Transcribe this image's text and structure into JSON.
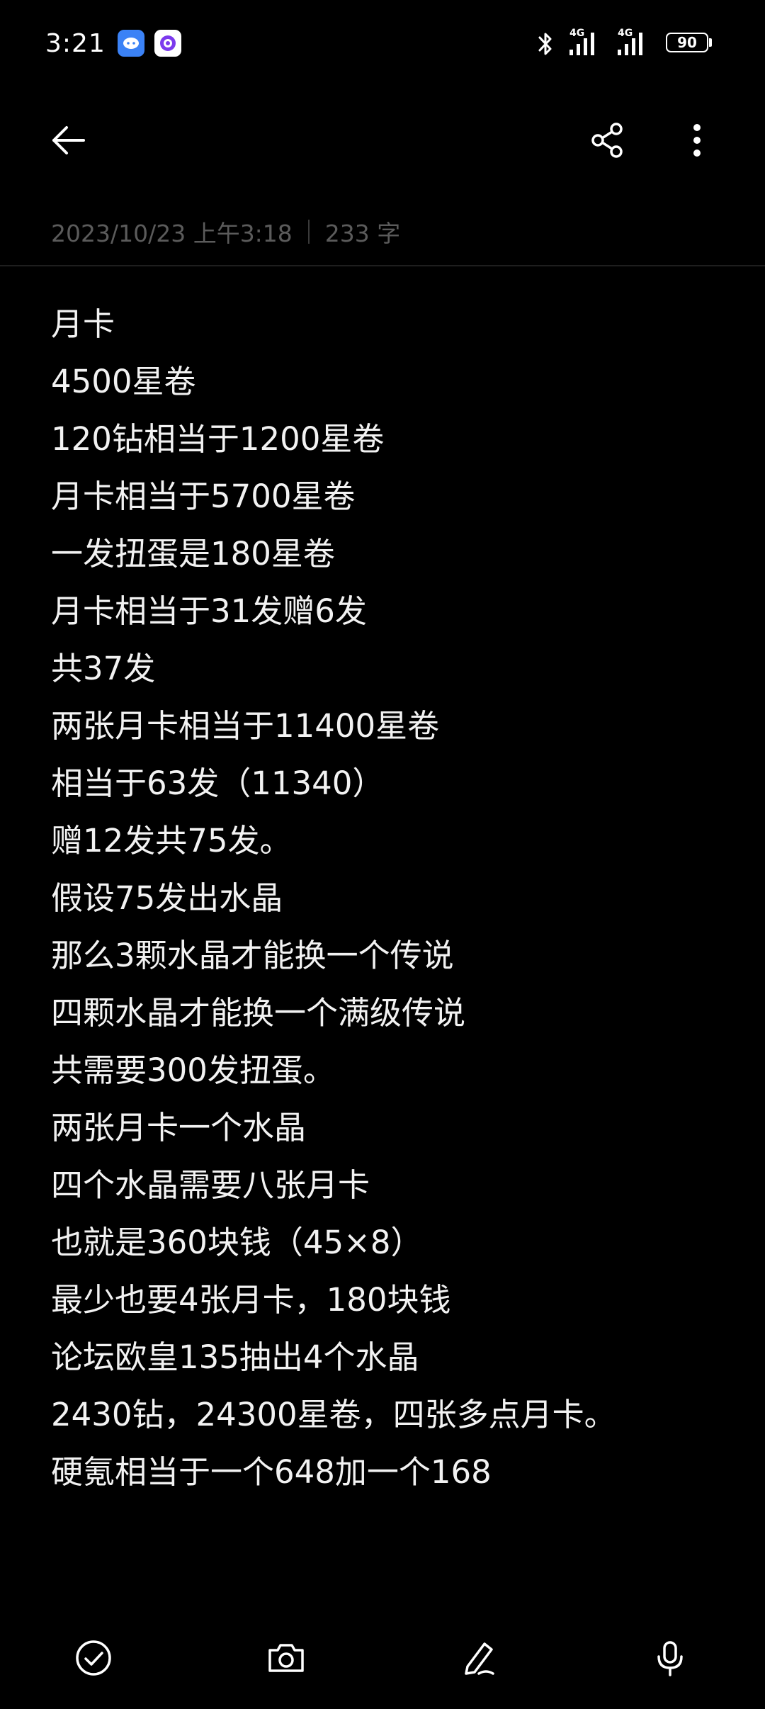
{
  "status_bar": {
    "time": "3:21",
    "network_1": "4G",
    "network_2": "4G",
    "battery": "90"
  },
  "app_bar": {
    "back_icon": "arrow-left-icon",
    "share_icon": "share-icon",
    "more_icon": "more-vertical-icon"
  },
  "note": {
    "datetime": "2023/10/23 上午3:18",
    "word_count": "233 字",
    "lines": [
      "月卡",
      "4500星卷",
      "120钻相当于1200星卷",
      "月卡相当于5700星卷",
      "一发扭蛋是180星卷",
      "月卡相当于31发赠6发",
      "共37发",
      "两张月卡相当于11400星卷",
      "相当于63发（11340）",
      "赠12发共75发。",
      "假设75发出水晶",
      "那么3颗水晶才能换一个传说",
      "四颗水晶才能换一个满级传说",
      "共需要300发扭蛋。",
      "两张月卡一个水晶",
      "四个水晶需要八张月卡",
      "也就是360块钱（45×8）",
      "最少也要4张月卡，180块钱",
      "论坛欧皇135抽出4个水晶",
      "2430钻，24300星卷，四张多点月卡。",
      "硬氪相当于一个648加一个168"
    ]
  },
  "toolbar": {
    "items": [
      "check-circle-icon",
      "camera-icon",
      "pen-icon",
      "microphone-icon"
    ]
  },
  "colors": {
    "background": "#000000",
    "text": "#f2f2f2",
    "meta_text": "#5b5b5b",
    "app_icon_blue": "#3b82f6"
  }
}
